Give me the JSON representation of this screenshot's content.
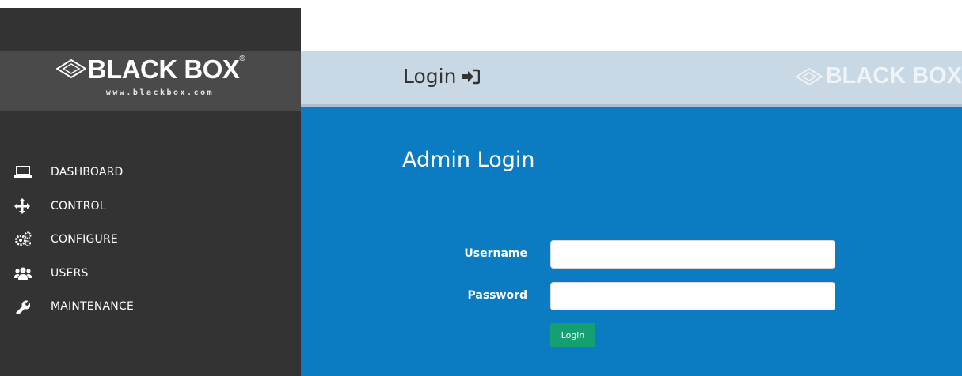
{
  "brand": {
    "logo_text": "BLACK BOX",
    "logo_url": "www.blackbox.com",
    "header_logo_text": "BLACK BOX"
  },
  "sidebar": {
    "items": [
      {
        "label": "DASHBOARD",
        "icon": "laptop-icon"
      },
      {
        "label": "CONTROL",
        "icon": "move-arrows-icon"
      },
      {
        "label": "CONFIGURE",
        "icon": "gears-icon"
      },
      {
        "label": "USERS",
        "icon": "users-icon"
      },
      {
        "label": "MAINTENANCE",
        "icon": "wrench-icon"
      }
    ]
  },
  "header": {
    "title": "Login",
    "title_icon": "sign-in-icon"
  },
  "main": {
    "title": "Admin Login",
    "username_label": "Username",
    "username_value": "",
    "password_label": "Password",
    "password_value": "",
    "login_button": "Login"
  },
  "colors": {
    "sidebar_bg": "#333333",
    "logo_band_bg": "#4a4a4a",
    "header_bg": "#c8d8e4",
    "main_bg": "#0b7cc1",
    "button_bg": "#14a070"
  }
}
